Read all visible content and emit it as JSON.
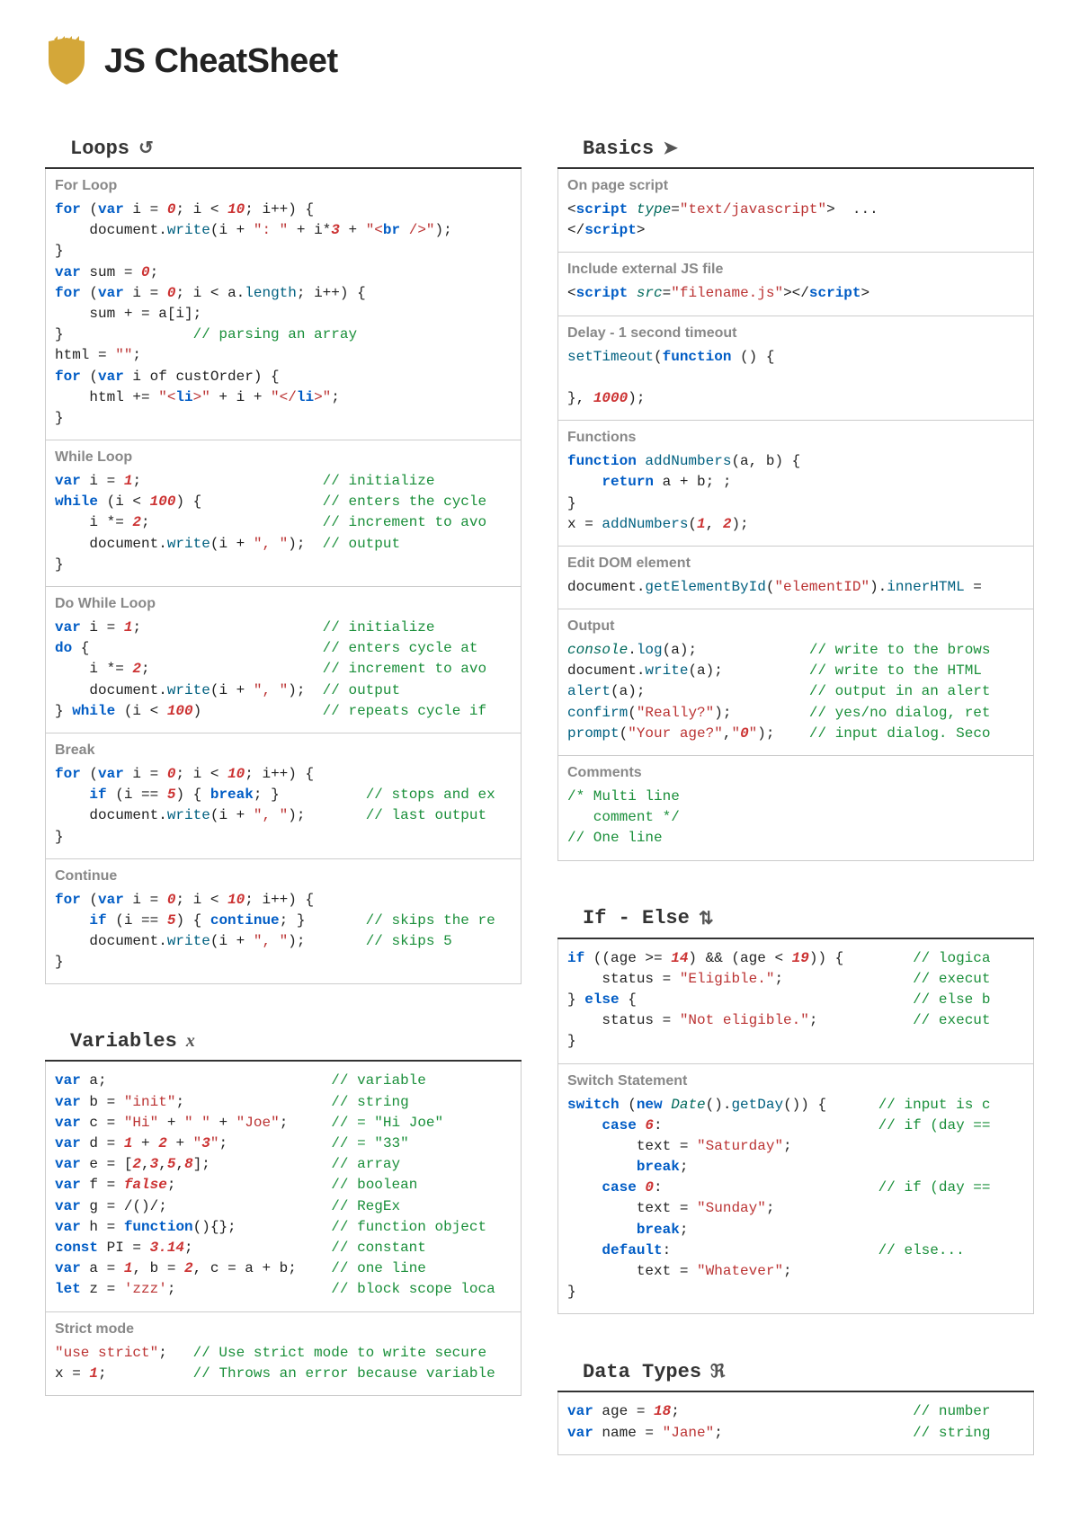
{
  "page_title": "JS CheatSheet",
  "sections": {
    "loops": {
      "title": "Loops",
      "icon": "↻",
      "blocks": [
        {
          "label": "For Loop",
          "code": "for (var i = 0; i < 10; i++) {\n    document.write(i + \": \" + i*3 + \"<br />\");\n}\nvar sum = 0;\nfor (var i = 0; i < a.length; i++) {\n    sum + = a[i];\n}               // parsing an array\nhtml = \"\";\nfor (var i of custOrder) {\n    html += \"<li>\" + i + \"</li>\";\n}"
        },
        {
          "label": "While Loop",
          "code": "var i = 1;                     // initialize\nwhile (i < 100) {              // enters the cycle\n    i *= 2;                    // increment to avo\n    document.write(i + \", \");  // output\n}"
        },
        {
          "label": "Do While Loop",
          "code": "var i = 1;                     // initialize\ndo {                           // enters cycle at\n    i *= 2;                    // increment to avo\n    document.write(i + \", \");  // output\n} while (i < 100)              // repeats cycle if"
        },
        {
          "label": "Break",
          "code": "for (var i = 0; i < 10; i++) {\n    if (i == 5) { break; }          // stops and ex\n    document.write(i + \", \");       // last output\n}"
        },
        {
          "label": "Continue",
          "code": "for (var i = 0; i < 10; i++) {\n    if (i == 5) { continue; }       // skips the re\n    document.write(i + \", \");       // skips 5\n}"
        }
      ]
    },
    "variables": {
      "title": "Variables",
      "icon": "x",
      "blocks": [
        {
          "label": "",
          "code": "var a;                          // variable\nvar b = \"init\";                 // string\nvar c = \"Hi\" + \" \" + \"Joe\";     // = \"Hi Joe\"\nvar d = 1 + 2 + \"3\";            // = \"33\"\nvar e = [2,3,5,8];              // array\nvar f = false;                  // boolean\nvar g = /()/;                   // RegEx\nvar h = function(){};           // function object\nconst PI = 3.14;                // constant\nvar a = 1, b = 2, c = a + b;    // one line\nlet z = 'zzz';                  // block scope loca"
        },
        {
          "label": "Strict mode",
          "code": "\"use strict\";   // Use strict mode to write secure\nx = 1;          // Throws an error because variable"
        }
      ]
    },
    "basics": {
      "title": "Basics",
      "icon": "➤",
      "blocks": [
        {
          "label": "On page script",
          "code": "<script type=\"text/javascript\">  ...\n</script>"
        },
        {
          "label": "Include external JS file",
          "code": "<script src=\"filename.js\"></script>"
        },
        {
          "label": "Delay - 1 second timeout",
          "code": "setTimeout(function () {\n\n}, 1000);"
        },
        {
          "label": "Functions",
          "code": "function addNumbers(a, b) {\n    return a + b; ;\n}\nx = addNumbers(1, 2);"
        },
        {
          "label": "Edit DOM element",
          "code": "document.getElementById(\"elementID\").innerHTML = "
        },
        {
          "label": "Output",
          "code": "console.log(a);             // write to the brows\ndocument.write(a);          // write to the HTML\nalert(a);                   // output in an alert\nconfirm(\"Really?\");         // yes/no dialog, ret\nprompt(\"Your age?\",\"0\");    // input dialog. Seco"
        },
        {
          "label": "Comments",
          "code": "/* Multi line\n   comment */\n// One line"
        }
      ]
    },
    "ifelse": {
      "title": "If - Else",
      "icon": "⇅",
      "blocks": [
        {
          "label": "",
          "code": "if ((age >= 14) && (age < 19)) {        // logica\n    status = \"Eligible.\";               // execut\n} else {                                // else b\n    status = \"Not eligible.\";           // execut\n}"
        },
        {
          "label": "Switch Statement",
          "code": "switch (new Date().getDay()) {      // input is c\n    case 6:                         // if (day ==\n        text = \"Saturday\";\n        break;\n    case 0:                         // if (day ==\n        text = \"Sunday\";\n        break;\n    default:                        // else...\n        text = \"Whatever\";\n}"
        }
      ]
    },
    "datatypes": {
      "title": "Data Types",
      "icon": "ℜ",
      "blocks": [
        {
          "label": "",
          "code": "var age = 18;                           // number\nvar name = \"Jane\";                      // string"
        }
      ]
    }
  }
}
